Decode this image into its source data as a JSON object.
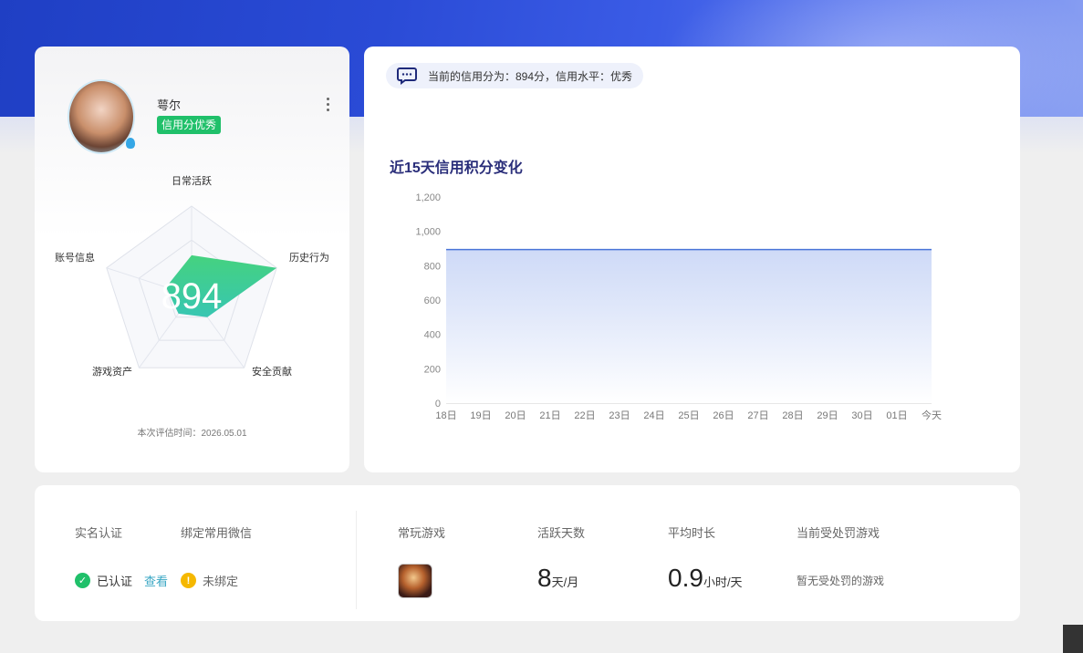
{
  "profile": {
    "username": "萼尔",
    "badge": "信用分优秀",
    "score": "894",
    "radar_labels": {
      "top": "日常活跃",
      "right": "历史行为",
      "bottom_right": "安全贡献",
      "bottom_left": "游戏资产",
      "left": "账号信息"
    },
    "radar_values": [
      0.45,
      1.0,
      0.3,
      0.25,
      0.3
    ],
    "eval_time": "本次评估时间：2026.05.01"
  },
  "summary": {
    "message": "当前的信用分为：894分，信用水平：优秀"
  },
  "chart_data": {
    "type": "area",
    "title": "近15天信用积分变化",
    "x": [
      "18日",
      "19日",
      "20日",
      "21日",
      "22日",
      "23日",
      "24日",
      "25日",
      "26日",
      "27日",
      "28日",
      "29日",
      "30日",
      "01日",
      "今天"
    ],
    "series": [
      {
        "values": [
          894,
          894,
          894,
          894,
          894,
          894,
          894,
          894,
          894,
          894,
          894,
          894,
          894,
          894,
          894
        ]
      }
    ],
    "yticks": [
      "0",
      "200",
      "400",
      "600",
      "800",
      "1,000",
      "1,200"
    ],
    "ylim": [
      0,
      1200
    ],
    "grid": false
  },
  "stats": {
    "real_name_label": "实名认证",
    "wechat_label": "绑定常用微信",
    "real_name_status": "已认证",
    "view_link": "查看",
    "wechat_status": "未绑定",
    "frequent_game_label": "常玩游戏",
    "active_days_label": "活跃天数",
    "active_days_value": "8",
    "active_days_unit": "天/月",
    "avg_time_label": "平均时长",
    "avg_time_value": "0.9",
    "avg_time_unit": "小时/天",
    "penalty_label": "当前受处罚游戏",
    "penalty_value": "暂无受处罚的游戏"
  },
  "colors": {
    "banner": "#2a4bd6",
    "badge": "#20c06a",
    "radar_fill": "#3ccf98",
    "chart_line": "#4a74d8",
    "link": "#3aa7c4",
    "warn": "#f5b800"
  }
}
